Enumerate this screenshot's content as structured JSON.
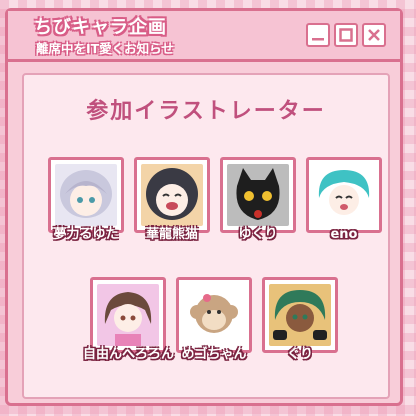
{
  "window": {
    "title": "ちびキャラ企画",
    "subtitle": "離席中をIT愛くお知らせ",
    "buttons": {
      "minimize": "minimize-icon",
      "maximize": "maximize-icon",
      "close": "close-icon"
    }
  },
  "content": {
    "heading": "参加イラストレーター",
    "artists": [
      {
        "name": "夢力るゆた",
        "icon": "avatar-silver-hair"
      },
      {
        "name": "華龍熊猫",
        "icon": "avatar-dark-hair"
      },
      {
        "name": "ゆくり",
        "icon": "avatar-black-cat"
      },
      {
        "name": "eno",
        "icon": "avatar-teal-hair"
      },
      {
        "name": "自由んへろろん",
        "icon": "avatar-brown-twintail"
      },
      {
        "name": "めゴちゃん",
        "icon": "avatar-monkey"
      },
      {
        "name": "ぐり",
        "icon": "avatar-green-hair"
      }
    ]
  },
  "colors": {
    "accent": "#d9708f",
    "heading": "#c0507d",
    "background": "#f9dde6"
  }
}
